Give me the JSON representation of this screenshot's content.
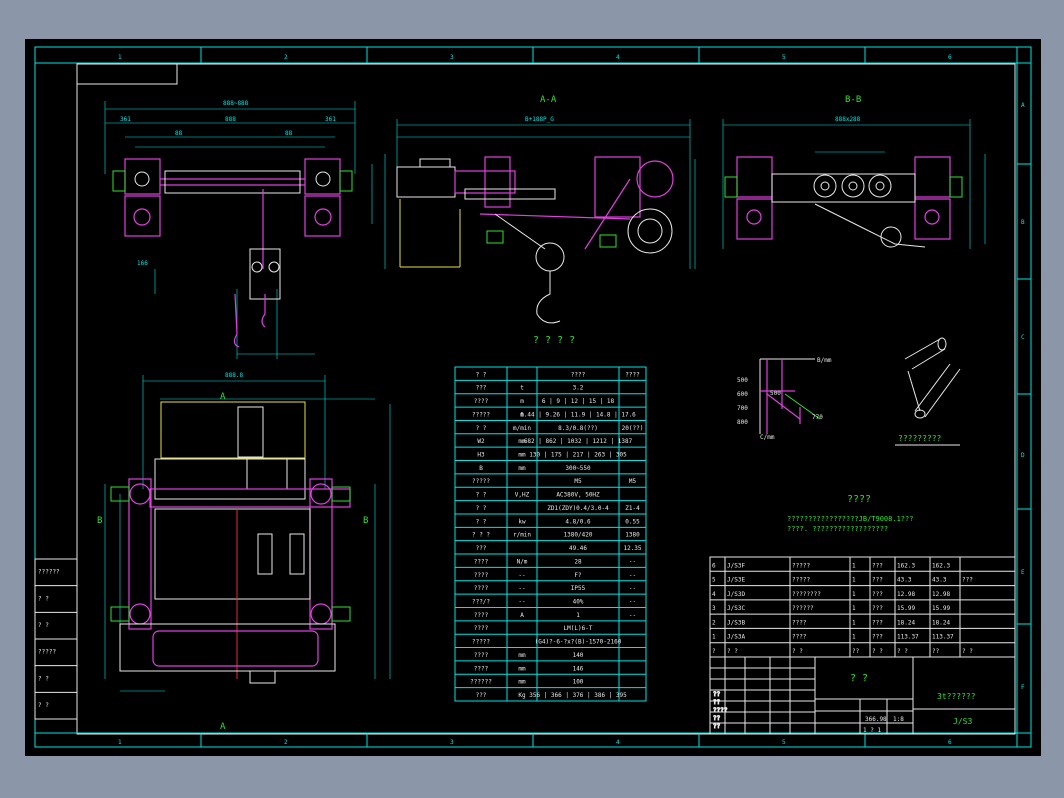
{
  "frame": {
    "zones_top": [
      "1",
      "2",
      "3",
      "4",
      "5",
      "6"
    ],
    "zones_side": [
      "A",
      "B",
      "C",
      "D",
      "E",
      "F"
    ]
  },
  "views": {
    "section_aa": "A-A",
    "section_bb": "B-B",
    "view_label_a": "A",
    "view_label_b": "B",
    "side_view_title": "? ? ? ?",
    "curve_title": "?????????",
    "tech_req_title": "????"
  },
  "tech_notes": [
    "?????????????????JB/T9008.1???",
    "????. ??????????????????"
  ],
  "curve": {
    "y_ticks": [
      "500",
      "600",
      "700",
      "800"
    ],
    "top_label": "B/mm",
    "side_label": "C/mm",
    "marks": [
      "500",
      "770"
    ]
  },
  "spec_table": {
    "rows": [
      [
        "? ?",
        "",
        "????",
        "????"
      ],
      [
        "???",
        "t",
        "3.2",
        ""
      ],
      [
        "????",
        "m",
        "6 | 9 | 12 | 15 | 18",
        ""
      ],
      [
        "?????",
        "m",
        "6.44 | 9.26 | 11.9 | 14.8 | 17.6",
        ""
      ],
      [
        "? ?",
        "m/min",
        "8.3/0.8(??)",
        "20(??)"
      ],
      [
        "W2",
        "mm",
        "682 | 862 | 1032 | 1212 | 1387",
        ""
      ],
      [
        "H3",
        "mm",
        "130 | 175 | 217 | 263 | 305",
        ""
      ],
      [
        "B",
        "mm",
        "300~550",
        ""
      ],
      [
        "?????",
        "",
        "M5",
        "M5"
      ],
      [
        "? ?",
        "V,HZ",
        "AC380V, 50HZ",
        ""
      ],
      [
        "? ?",
        "",
        "ZD1(ZDY)0.4/3.0-4",
        "Z1-4"
      ],
      [
        "? ?",
        "kw",
        "4.8/0.6",
        "0.55"
      ],
      [
        "? ? ?",
        "r/min",
        "1380/420",
        "1380"
      ],
      [
        "???",
        "",
        "49.46",
        "12.35"
      ],
      [
        "????",
        "N/m",
        "28",
        "--"
      ],
      [
        "????",
        "--",
        "F?",
        "--"
      ],
      [
        "????",
        "--",
        "IP55",
        "--"
      ],
      [
        "???/?",
        "--",
        "40%",
        "--"
      ],
      [
        "????",
        "A",
        "1",
        "--"
      ],
      [
        "????",
        "",
        "LM(L)6-T",
        ""
      ],
      [
        "?????",
        "",
        "(G4)?-6-?x?(B)-1570-2160",
        ""
      ],
      [
        "????",
        "mm",
        "140",
        ""
      ],
      [
        "????",
        "mm",
        "146",
        ""
      ],
      [
        "??????",
        "mm",
        "100",
        ""
      ],
      [
        "???",
        "Kg",
        "356 | 366 | 376 | 386 | 395",
        ""
      ]
    ]
  },
  "parts_list": {
    "rows": [
      [
        "6",
        "J/S3F",
        "?????",
        "1",
        "???",
        "162.3",
        "162.3",
        ""
      ],
      [
        "5",
        "J/S3E",
        "?????",
        "1",
        "???",
        "43.3",
        "43.3",
        "???"
      ],
      [
        "4",
        "J/S3D",
        "????????",
        "1",
        "???",
        "12.98",
        "12.98",
        ""
      ],
      [
        "3",
        "J/S3C",
        "??????",
        "1",
        "???",
        "15.99",
        "15.99",
        ""
      ],
      [
        "2",
        "J/S3B",
        "????",
        "1",
        "???",
        "18.24",
        "18.24",
        ""
      ],
      [
        "1",
        "J/S3A",
        "????",
        "1",
        "???",
        "113.37",
        "113.37",
        ""
      ],
      [
        "?",
        "? ?",
        "? ?",
        "??",
        "? ?",
        "? ?",
        "??",
        "? ?"
      ]
    ]
  },
  "title_block": {
    "drawing_title": "? ?",
    "product_name": "3t??????",
    "drawing_number": "J/S3",
    "weight": "366.98",
    "scale": "1:8",
    "sheet": "1 ? 1",
    "sign_rows": [
      "??",
      "??",
      "????",
      "??",
      "??"
    ]
  },
  "left_block": {
    "rows": [
      "??????",
      "? ?",
      "? ?",
      "?????",
      "? ?",
      "? ?"
    ]
  },
  "colors": {
    "background": "#000000",
    "frame": "#00e5e5",
    "part": "#e040e0",
    "outline": "#e8e8e8",
    "text": "#30e030",
    "hidden": "#e8e040"
  }
}
